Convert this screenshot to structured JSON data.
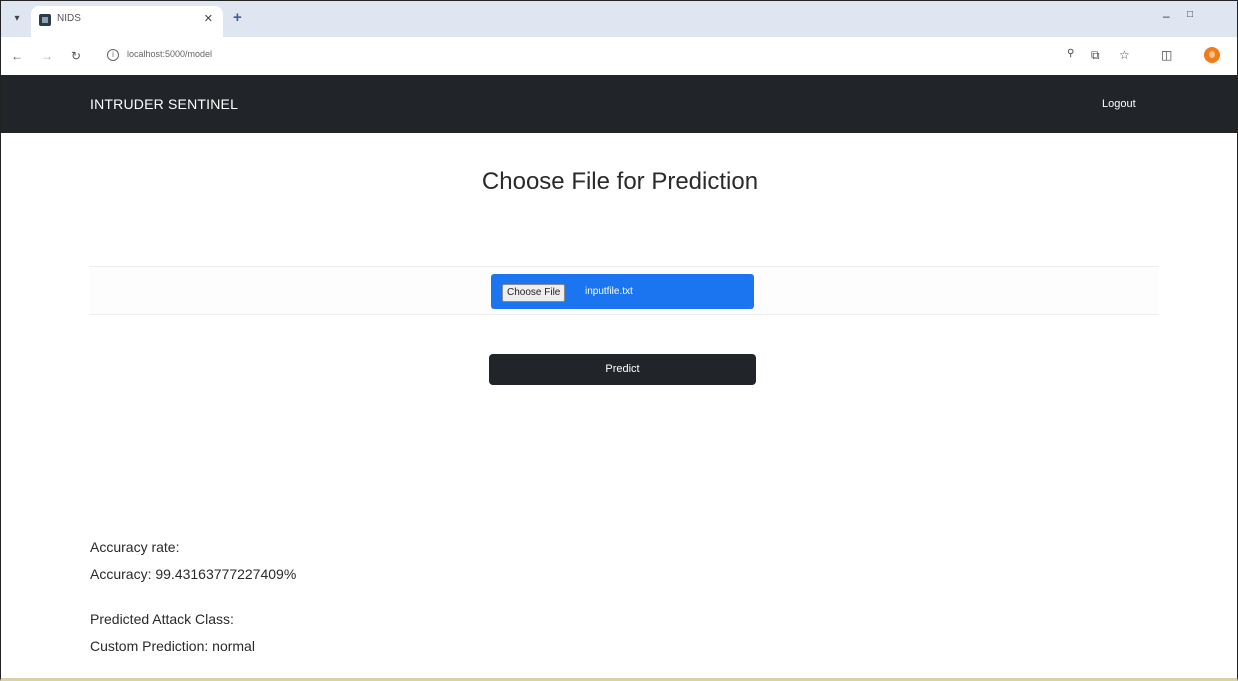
{
  "browser": {
    "tab_title": "NIDS",
    "url": "localhost:5000/model",
    "icons": [
      "tab-menu-icon",
      "favicon-icon",
      "close-icon",
      "plus-icon",
      "minimize-icon",
      "maximize-icon",
      "back-icon",
      "forward-icon",
      "reload-icon",
      "info-icon",
      "key-icon",
      "translate-icon",
      "star-icon",
      "extensions-icon",
      "profile-icon"
    ],
    "profile_color": "#f07c1a"
  },
  "navbar": {
    "brand": "INTRUDER SENTINEL",
    "logout_label": "Logout",
    "background": "#212529"
  },
  "main": {
    "title": "Choose File for Prediction",
    "file_input": {
      "button_label": "Choose File",
      "file_name": "inputfile.txt",
      "accent": "#1b74f0"
    },
    "predict_label": "Predict"
  },
  "results": {
    "accuracy_heading": "Accuracy rate:",
    "accuracy_value": "Accuracy: 99.43163777227409%",
    "class_heading": "Predicted Attack Class:",
    "class_value": "Custom Prediction: normal"
  }
}
